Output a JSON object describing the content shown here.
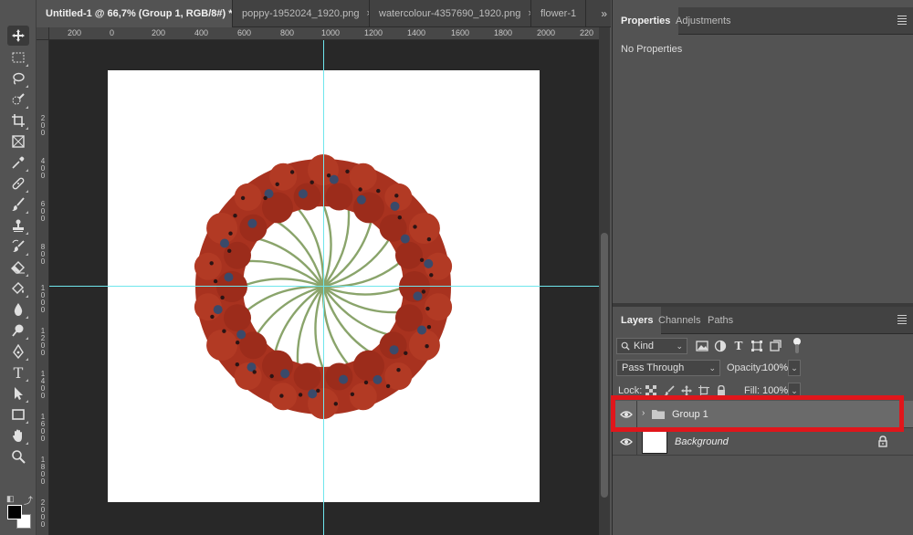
{
  "document_tabs": [
    {
      "label": "Untitled-1 @ 66,7% (Group 1, RGB/8#) *",
      "close": "×",
      "active": true
    },
    {
      "label": "poppy-1952024_1920.png",
      "close": "×",
      "active": false
    },
    {
      "label": "watercolour-4357690_1920.png",
      "close": "×",
      "active": false
    },
    {
      "label": "flower-1",
      "close": "",
      "active": false
    }
  ],
  "tab_overflow": "»",
  "ruler": {
    "top_labels": [
      "200",
      "0",
      "200",
      "400",
      "600",
      "800",
      "1000",
      "1200",
      "1400",
      "1600",
      "1800",
      "2000",
      "220"
    ],
    "left_labels": [
      "2\n0\n0",
      "4\n0\n0",
      "6\n0\n0",
      "8\n0\n0",
      "1\n0\n0\n0",
      "1\n2\n0\n0",
      "1\n4\n0\n0",
      "1\n6\n0\n0",
      "1\n8\n0\n0",
      "2\n0\n0\n0"
    ]
  },
  "tools": [
    {
      "name": "move-tool",
      "icon": "move-icon"
    },
    {
      "name": "marquee-tool",
      "icon": "rect-marquee-icon"
    },
    {
      "name": "lasso-tool",
      "icon": "lasso-icon"
    },
    {
      "name": "quick-selection-tool",
      "icon": "quick-select-icon"
    },
    {
      "name": "crop-tool",
      "icon": "crop-icon"
    },
    {
      "name": "frame-tool",
      "icon": "frame-icon"
    },
    {
      "name": "eyedropper-tool",
      "icon": "eyedropper-icon"
    },
    {
      "name": "healing-brush-tool",
      "icon": "bandage-icon"
    },
    {
      "name": "brush-tool",
      "icon": "brush-icon"
    },
    {
      "name": "clone-stamp-tool",
      "icon": "stamp-icon"
    },
    {
      "name": "history-brush-tool",
      "icon": "history-brush-icon"
    },
    {
      "name": "eraser-tool",
      "icon": "eraser-icon"
    },
    {
      "name": "paint-bucket-tool",
      "icon": "bucket-icon"
    },
    {
      "name": "blur-tool",
      "icon": "drop-icon"
    },
    {
      "name": "dodge-tool",
      "icon": "dodge-icon"
    },
    {
      "name": "pen-tool",
      "icon": "pen-icon"
    },
    {
      "name": "type-tool",
      "icon": "type-icon",
      "glyph": "T"
    },
    {
      "name": "path-selection-tool",
      "icon": "arrow-icon"
    },
    {
      "name": "rectangle-tool",
      "icon": "rectangle-icon"
    },
    {
      "name": "hand-tool",
      "icon": "hand-icon"
    },
    {
      "name": "zoom-tool",
      "icon": "zoom-icon"
    }
  ],
  "properties_panel": {
    "tabs": [
      "Properties",
      "Adjustments"
    ],
    "empty_text": "No Properties"
  },
  "layers_panel": {
    "tabs": [
      "Layers",
      "Channels",
      "Paths"
    ],
    "filter_kind": "Kind",
    "blend_mode": "Pass Through",
    "opacity_label": "Opacity:",
    "opacity_value": "100%",
    "lock_label": "Lock:",
    "fill_label": "Fill:",
    "fill_value": "100%",
    "layers": [
      {
        "name": "Group 1",
        "type": "group",
        "selected": true,
        "visible": true
      },
      {
        "name": "Background",
        "type": "background",
        "selected": false,
        "visible": true,
        "locked": true
      }
    ]
  },
  "colors": {
    "guide": "#6fe6ec",
    "highlight": "#e0161b",
    "petal": "#a8321f",
    "stem": "#8aa46b"
  }
}
